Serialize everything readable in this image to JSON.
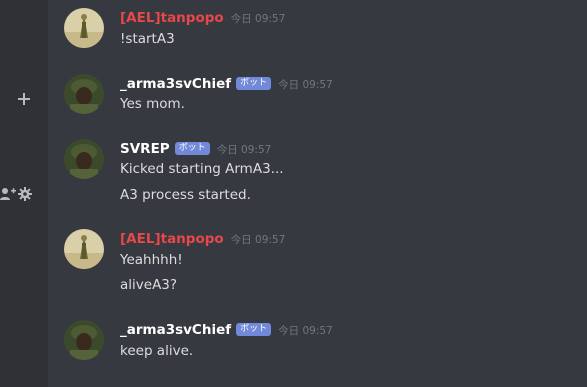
{
  "sidebar": {
    "add_icon": "plus-icon",
    "add_user_icon": "add-user-icon",
    "settings_icon": "gear-icon"
  },
  "messages": [
    {
      "author": "[AEL]tanpopo",
      "author_color": "#e84849",
      "bot": false,
      "timestamp": "今日 09:57",
      "lines": [
        "!startA3"
      ]
    },
    {
      "author": "_arma3svChief",
      "author_color": "#ffffff",
      "bot": true,
      "bot_label": "ボット",
      "timestamp": "今日 09:57",
      "lines": [
        "Yes mom."
      ]
    },
    {
      "author": "SVREP",
      "author_color": "#ffffff",
      "bot": true,
      "bot_label": "ボット",
      "timestamp": "今日 09:57",
      "lines": [
        "Kicked starting ArmA3...",
        "A3 process started."
      ]
    },
    {
      "author": "[AEL]tanpopo",
      "author_color": "#e84849",
      "bot": false,
      "timestamp": "今日 09:57",
      "lines": [
        "Yeahhhh!",
        "aliveA3?"
      ]
    },
    {
      "author": "_arma3svChief",
      "author_color": "#ffffff",
      "bot": true,
      "bot_label": "ボット",
      "timestamp": "今日 09:57",
      "lines": [
        "keep alive."
      ]
    }
  ],
  "colors": {
    "background": "#36393f",
    "sidebar": "#2f3136",
    "bot_tag": "#7289da",
    "timestamp": "#72767d",
    "text": "#dcddde"
  }
}
